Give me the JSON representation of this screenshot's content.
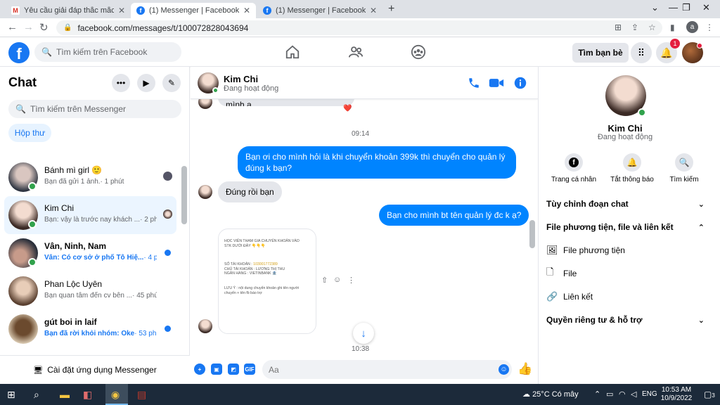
{
  "browser": {
    "tabs": [
      {
        "label": "Yêu cầu giải đáp thắc mắc - anhtu",
        "icon": "gmail-icon",
        "active": false
      },
      {
        "label": "(1) Messenger | Facebook",
        "icon": "facebook-icon",
        "active": true
      },
      {
        "label": "(1) Messenger | Facebook",
        "icon": "facebook-icon",
        "active": false
      }
    ],
    "url": "facebook.com/messages/t/100072828043694",
    "profile_initial": "a"
  },
  "fb_header": {
    "logo": "f",
    "search_placeholder": "Tìm kiếm trên Facebook",
    "find_friends": "Tìm bạn bè",
    "notification_count": "1"
  },
  "sidebar": {
    "title": "Chat",
    "search_placeholder": "Tìm kiếm trên Messenger",
    "inbox_label": "Hộp thư",
    "conversations": [
      {
        "name": "Bánh mì girl 🙂",
        "preview": "Bạn đã gửi 1 ảnh.",
        "time": "· 1 phút",
        "online": true,
        "unread": false,
        "selected": false
      },
      {
        "name": "Kim Chi",
        "preview": "Bạn: vậy là trước nay khách ...",
        "time": "· 2 phút",
        "online": true,
        "unread": false,
        "selected": true
      },
      {
        "name": "Vân, Ninh, Nam",
        "preview": "Vân: Có cơ sở ở phố Tô Hiệ...",
        "time": "· 4 phút",
        "online": true,
        "unread": true,
        "selected": false
      },
      {
        "name": "Phan Lộc Uyên",
        "preview": "Bạn quan tâm đến cv bên ...",
        "time": "· 45 phút",
        "online": false,
        "unread": false,
        "selected": false
      },
      {
        "name": "gút boi in laif",
        "preview": "Bạn đã rời khỏi nhóm: Oke",
        "time": "· 53 phút",
        "online": false,
        "unread": true,
        "selected": false
      }
    ],
    "install_label": "Cài đặt ứng dụng Messenger"
  },
  "chat": {
    "contact_name": "Kim Chi",
    "contact_status": "Đang hoạt động",
    "messages": [
      {
        "type": "in",
        "text": "Ok bạn nhé nào làm thì nhắn mình ạ",
        "reaction": "❤️"
      },
      {
        "type": "time",
        "text": "09:14"
      },
      {
        "type": "out",
        "text": "Bạn ơi cho mình hỏi là khi chuyển khoản 399k thì chuyển cho quản lý đúng k bạn?"
      },
      {
        "type": "in",
        "text": "Đúng rồi bạn"
      },
      {
        "type": "out",
        "text": "Bạn cho mình bt tên quản lý đc k ạ?"
      },
      {
        "type": "time",
        "text": "10:38"
      }
    ],
    "image_message": {
      "line1": "HỌC VIÊN THAM GIA CHUYỂN KHOẢN VÀO",
      "line2": "STK DƯỚI ĐÂY 👇👇👇",
      "account_label": "SỐ TÀI KHOẢN : ",
      "account_number": "103001772389",
      "holder": "CHỦ TÀI KHOẢN : LƯƠNG THỊ THU",
      "bank": "NGÂN HÀNG : VIETINBANK 🏦",
      "note": "LƯU Ý : nội dung chuyển khoản ghi tên người chuyển + tên fb báo trợ"
    },
    "composer_placeholder": "Aa"
  },
  "info_panel": {
    "name": "Kim Chi",
    "status": "Đang hoạt động",
    "actions": [
      {
        "label": "Trang cá nhân",
        "icon": "facebook-icon"
      },
      {
        "label": "Tắt thông báo",
        "icon": "bell-icon"
      },
      {
        "label": "Tìm kiếm",
        "icon": "search-icon"
      }
    ],
    "sections": {
      "customize": "Tùy chỉnh đoạn chat",
      "media_files_links": "File phương tiện, file và liên kết",
      "media": "File phương tiện",
      "files": "File",
      "links": "Liên kết",
      "privacy": "Quyền riêng tư & hỗ trợ"
    }
  },
  "taskbar": {
    "weather": "25°C  Có mây",
    "language": "ENG",
    "time": "10:53 AM",
    "date": "10/9/2022",
    "notification_count": "3"
  },
  "colors": {
    "fb_blue": "#1877f2",
    "bubble_out": "#0084ff",
    "online": "#31a24c"
  }
}
